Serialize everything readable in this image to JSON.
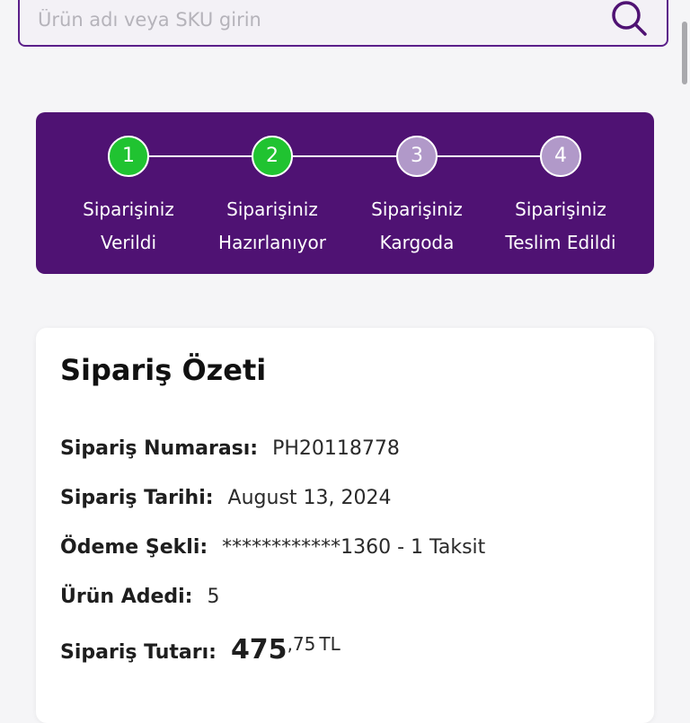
{
  "search": {
    "placeholder": "Ürün adı veya SKU girin",
    "icon": "search-icon"
  },
  "tracker": {
    "steps": [
      {
        "number": "1",
        "line1": "Siparişiniz",
        "line2": "Verildi",
        "completed": true
      },
      {
        "number": "2",
        "line1": "Siparişiniz",
        "line2": "Hazırlanıyor",
        "completed": true
      },
      {
        "number": "3",
        "line1": "Siparişiniz",
        "line2": "Kargoda",
        "completed": false
      },
      {
        "number": "4",
        "line1": "Siparişiniz",
        "line2": "Teslim Edildi",
        "completed": false
      }
    ]
  },
  "summary": {
    "title": "Sipariş Özeti",
    "order_number": {
      "label": "Sipariş Numarası:",
      "value": "PH20118778"
    },
    "order_date": {
      "label": "Sipariş Tarihi:",
      "value": "August 13, 2024"
    },
    "payment": {
      "label": "Ödeme Şekli:",
      "value": "************1360 - 1 Taksit"
    },
    "item_count": {
      "label": "Ürün Adedi:",
      "value": "5"
    },
    "total": {
      "label": "Sipariş Tutarı:",
      "whole": "475",
      "cents": ",75",
      "currency": "TL"
    }
  },
  "colors": {
    "brand_purple": "#4f1273",
    "completed_green": "#20c331",
    "pending_lavender": "#b199c9",
    "search_border": "#5b1f8a"
  }
}
